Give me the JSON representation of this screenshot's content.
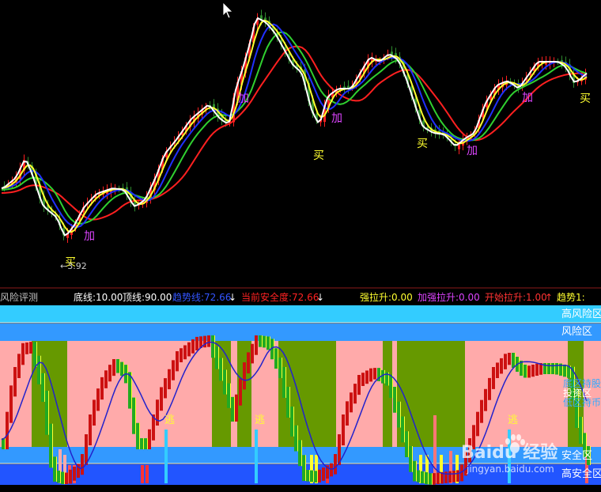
{
  "colors": {
    "background": "#000000",
    "up_candle": "#ff2020",
    "down_candle": "#2e8b2e",
    "ma_white": "#ffffff",
    "ma_yellow": "#ffff30",
    "ma_blue": "#2030ff",
    "ma_green": "#30d030",
    "ma_red": "#ff2020",
    "high_risk": "#33ccff",
    "risk": "#3399ff",
    "pink_zone": "#ffaaaa",
    "olive_zone": "#669900",
    "safe_zone": "#3399ff",
    "high_safe_zone": "#2255ff",
    "line_blue": "#2222cc"
  },
  "price_panel": {
    "signals": [
      {
        "text": "加",
        "color": "#dd44ff"
      },
      {
        "text": "加",
        "color": "#dd44ff"
      },
      {
        "text": "买",
        "color": "#ffff30"
      },
      {
        "text": "买",
        "color": "#ffff30"
      },
      {
        "text": "加",
        "color": "#dd44ff"
      },
      {
        "text": "加",
        "color": "#dd44ff"
      },
      {
        "text": "加",
        "color": "#dd44ff"
      },
      {
        "text": "买",
        "color": "#ffff30"
      },
      {
        "text": "买",
        "color": "#ffff30"
      }
    ],
    "low_marker": "←3.92"
  },
  "indicator_header": {
    "name": "风险评测",
    "items": [
      {
        "text": "底线:10.00",
        "color": "#ffffff"
      },
      {
        "text": "顶线:90.00",
        "color": "#ffffff"
      },
      {
        "text": "趋势线:72.66",
        "color": "#3355ff"
      },
      {
        "text": "↓",
        "color": "#ffffff"
      },
      {
        "text": "当前安全度:72.66",
        "color": "#ff2222"
      },
      {
        "text": "↓",
        "color": "#ffffff"
      },
      {
        "text": "强拉升:0.00",
        "color": "#ffff30"
      },
      {
        "text": "加强拉升:0.00",
        "color": "#dd44ff"
      },
      {
        "text": "开始拉升:1.00",
        "color": "#ff3333"
      },
      {
        "text": "↑",
        "color": "#ff3333"
      },
      {
        "text": "趋势1:",
        "color": "#ffff30"
      }
    ]
  },
  "indicator_panel": {
    "zones": [
      "高风险区",
      "风险区",
      "安全区",
      "高安全区"
    ],
    "side_labels": [
      "底区持股",
      "投资区",
      "低区持币"
    ],
    "escape_label": "逃",
    "escape_markers": [
      "逃",
      "逃",
      "逃"
    ]
  },
  "watermark": {
    "brand": "Baidu 经验",
    "url": "jingyan.baidu.com"
  }
}
